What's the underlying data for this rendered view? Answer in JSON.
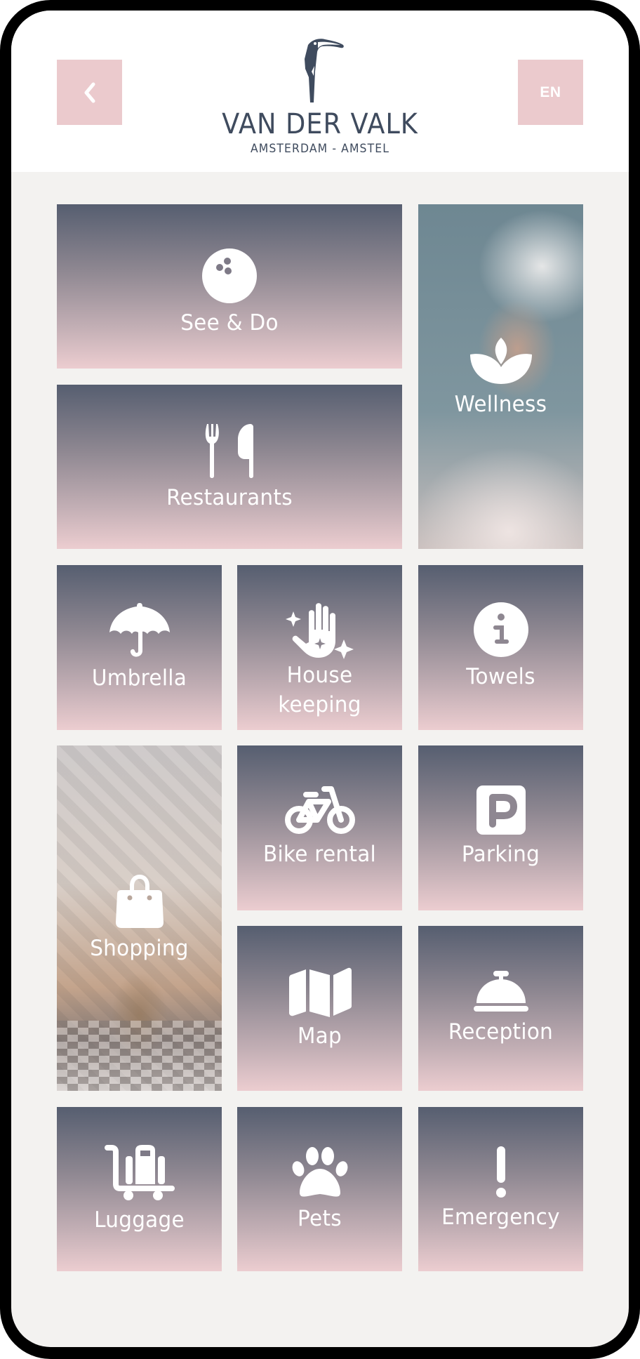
{
  "header": {
    "back_button": {
      "icon": "chevron-left-icon"
    },
    "logo": {
      "icon": "toucan-icon",
      "brand": "VAN DER VALK",
      "subtitle": "AMSTERDAM - AMSTEL"
    },
    "language_button": {
      "label": "EN"
    }
  },
  "tiles": [
    {
      "id": "see-do",
      "label": "See & Do",
      "icon": "bowling-ball-icon",
      "style": "gradient"
    },
    {
      "id": "wellness",
      "label": "Wellness",
      "icon": "lotus-icon",
      "style": "photo"
    },
    {
      "id": "restaurants",
      "label": "Restaurants",
      "icon": "fork-knife-icon",
      "style": "gradient"
    },
    {
      "id": "umbrella",
      "label": "Umbrella",
      "icon": "umbrella-icon",
      "style": "gradient"
    },
    {
      "id": "housekeeping",
      "label_line1": "House",
      "label_line2": "keeping",
      "icon": "sparkle-hand-icon",
      "style": "gradient"
    },
    {
      "id": "towels",
      "label": "Towels",
      "icon": "info-icon",
      "style": "gradient"
    },
    {
      "id": "shopping",
      "label": "Shopping",
      "icon": "shopping-bag-icon",
      "style": "photo"
    },
    {
      "id": "bike-rental",
      "label": "Bike rental",
      "icon": "bicycle-icon",
      "style": "gradient"
    },
    {
      "id": "parking",
      "label": "Parking",
      "icon": "parking-icon",
      "style": "gradient"
    },
    {
      "id": "map",
      "label": "Map",
      "icon": "map-icon",
      "style": "gradient"
    },
    {
      "id": "reception",
      "label": "Reception",
      "icon": "reception-bell-icon",
      "style": "gradient"
    },
    {
      "id": "luggage",
      "label": "Luggage",
      "icon": "luggage-cart-icon",
      "style": "gradient"
    },
    {
      "id": "pets",
      "label": "Pets",
      "icon": "paw-icon",
      "style": "gradient"
    },
    {
      "id": "emergency",
      "label": "Emergency",
      "icon": "exclamation-icon",
      "style": "gradient"
    }
  ],
  "colors": {
    "accent_pink": "#EBCACD",
    "brand_slate": "#3F4B5E",
    "gradient_top": "#565E70",
    "gradient_bottom": "#ECCDD0",
    "background": "#F3F2F0"
  }
}
